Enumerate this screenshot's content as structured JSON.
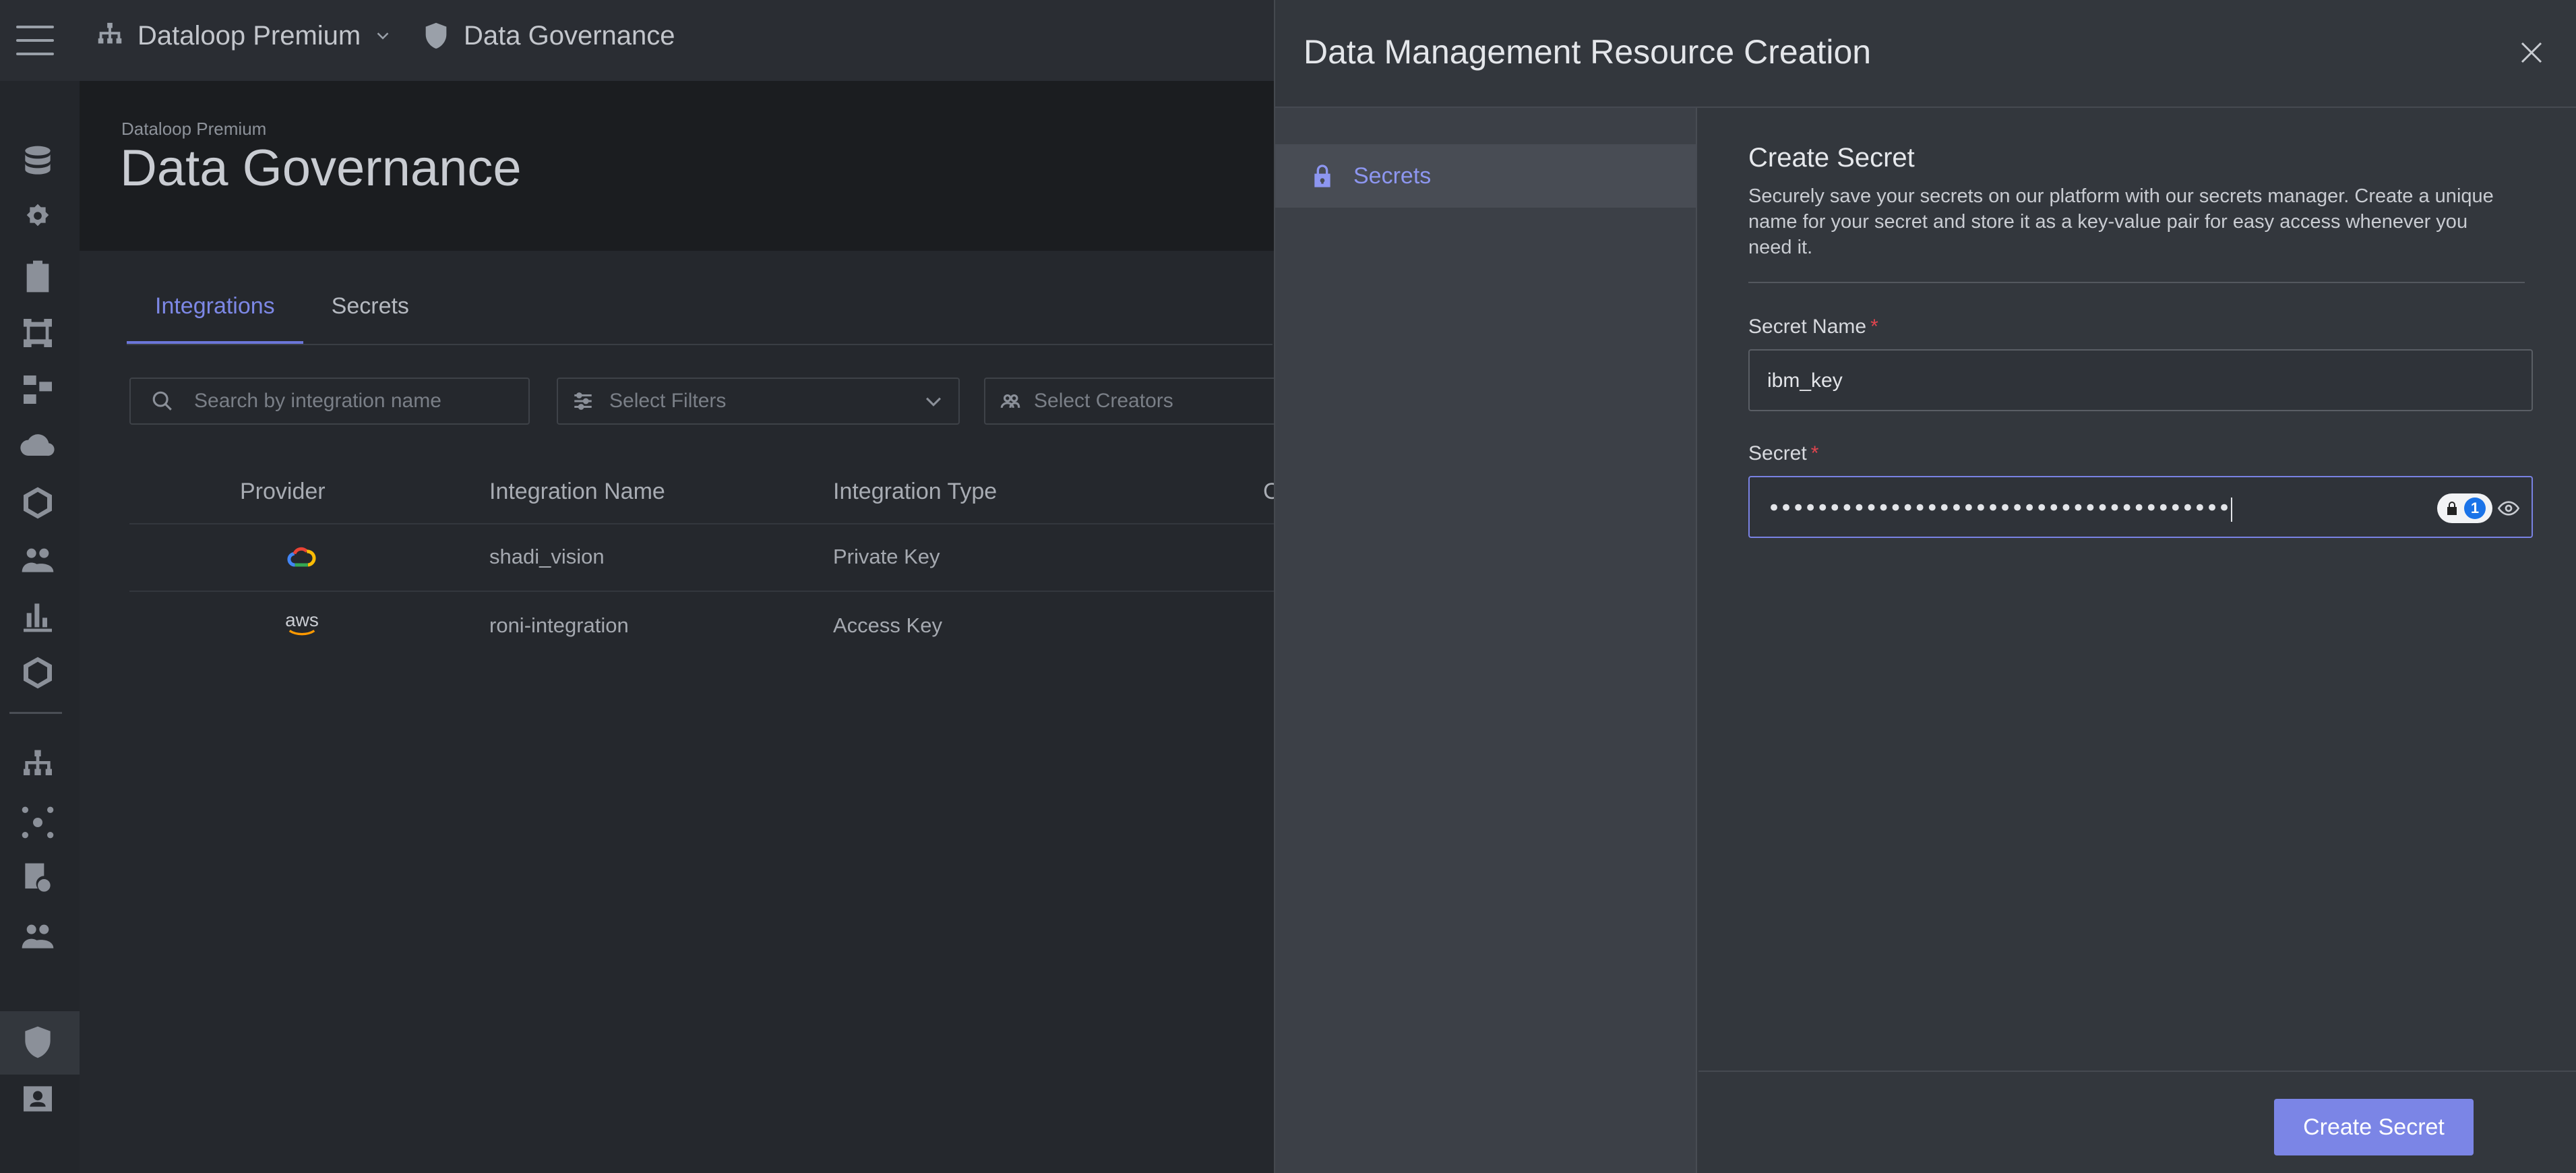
{
  "topbar": {
    "org_name": "Dataloop Premium",
    "section_name": "Data Governance"
  },
  "page": {
    "breadcrumb_small": "Dataloop Premium",
    "title": "Data Governance",
    "tabs": [
      {
        "label": "Integrations",
        "active": true
      },
      {
        "label": "Secrets",
        "active": false
      }
    ],
    "search_placeholder": "Search by integration name",
    "filters_placeholder": "Select Filters",
    "creators_placeholder": "Select Creators"
  },
  "table": {
    "headers": [
      "Provider",
      "Integration Name",
      "Integration Type",
      "C"
    ],
    "rows": [
      {
        "provider_icon": "google-cloud-icon",
        "name": "shadi_vision",
        "type": "Private Key"
      },
      {
        "provider_icon": "aws-icon",
        "provider_text": "aws",
        "name": "roni-integration",
        "type": "Access Key"
      }
    ]
  },
  "drawer": {
    "title": "Data Management Resource Creation",
    "side_items": [
      {
        "label": "Secrets",
        "icon": "lock-icon",
        "active": true
      }
    ],
    "form": {
      "title": "Create Secret",
      "description": "Securely save your secrets on our platform with our secrets manager. Create a unique name for your secret and store it as a key-value pair for easy access whenever you need it.",
      "secret_name_label": "Secret Name",
      "secret_name_value": "ibm_key",
      "secret_label": "Secret",
      "secret_masked": "••••••••••••••••••••••••••••••••••••••",
      "required_mark": "*",
      "password_manager_badge": "1"
    },
    "submit_label": "Create Secret"
  },
  "colors": {
    "accent": "#7b85e6",
    "required": "#e0454f",
    "drawer_bg": "#33373d"
  }
}
